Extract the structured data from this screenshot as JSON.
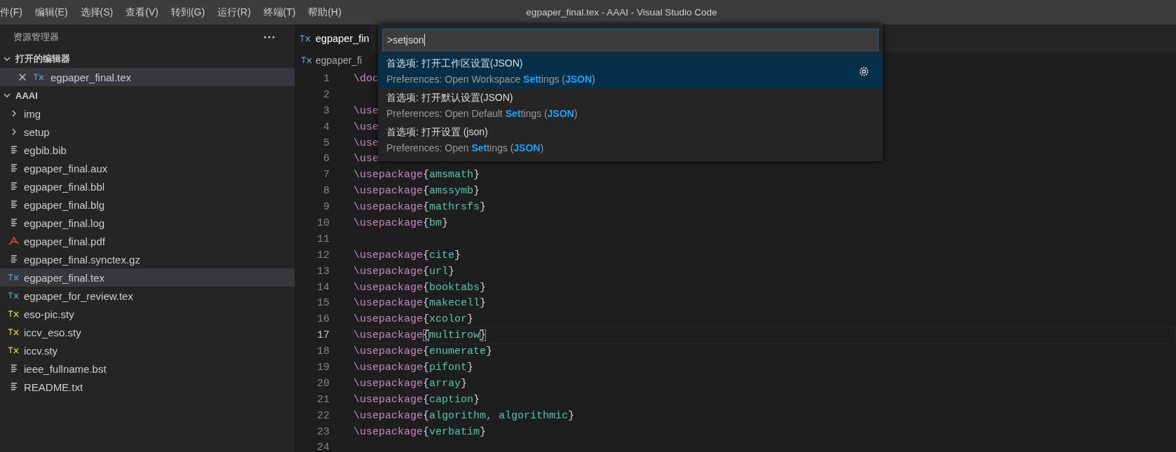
{
  "menu_bar": {
    "items": [
      "件(F)",
      "编辑(E)",
      "选择(S)",
      "查看(V)",
      "转到(G)",
      "运行(R)",
      "终端(T)",
      "帮助(H)"
    ],
    "title": "egpaper_final.tex - AAAI - Visual Studio Code"
  },
  "sidebar": {
    "title": "资源管理器",
    "open_editors": {
      "title": "打开的编辑器",
      "expanded": true,
      "items": [
        {
          "name": "egpaper_final.tex",
          "kind": "tex",
          "selected": true
        }
      ]
    },
    "folder": {
      "title": "AAAI",
      "expanded": true,
      "children": [
        {
          "name": "img",
          "kind": "folder",
          "expanded": false,
          "selected": false
        },
        {
          "name": "setup",
          "kind": "folder",
          "expanded": false,
          "selected": false
        },
        {
          "name": "egbib.bib",
          "kind": "text",
          "selected": false
        },
        {
          "name": "egpaper_final.aux",
          "kind": "text",
          "selected": false
        },
        {
          "name": "egpaper_final.bbl",
          "kind": "text",
          "selected": false
        },
        {
          "name": "egpaper_final.blg",
          "kind": "text",
          "selected": false
        },
        {
          "name": "egpaper_final.log",
          "kind": "text",
          "selected": false
        },
        {
          "name": "egpaper_final.pdf",
          "kind": "pdf",
          "selected": false
        },
        {
          "name": "egpaper_final.synctex.gz",
          "kind": "text",
          "selected": false
        },
        {
          "name": "egpaper_final.tex",
          "kind": "tex",
          "selected": true
        },
        {
          "name": "egpaper_for_review.tex",
          "kind": "tex",
          "selected": false
        },
        {
          "name": "eso-pic.sty",
          "kind": "sty",
          "selected": false
        },
        {
          "name": "iccv_eso.sty",
          "kind": "sty",
          "selected": false
        },
        {
          "name": "iccv.sty",
          "kind": "sty",
          "selected": false
        },
        {
          "name": "ieee_fullname.bst",
          "kind": "text",
          "selected": false
        },
        {
          "name": "README.txt",
          "kind": "text",
          "selected": false
        }
      ]
    }
  },
  "editor": {
    "tab": {
      "label": "egpaper_fin",
      "selected": true
    },
    "breadcrumb": "egpaper_fi",
    "lines": [
      {
        "number": "1",
        "command": "\\doc",
        "current": false
      },
      {
        "number": "2",
        "current": false
      },
      {
        "number": "3",
        "command": "\\use",
        "current": false
      },
      {
        "number": "4",
        "command": "\\use",
        "current": false
      },
      {
        "number": "5",
        "command": "\\use",
        "current": false
      },
      {
        "number": "6",
        "command": "\\use",
        "current": false
      },
      {
        "number": "7",
        "command": "\\usepackage",
        "open": "{",
        "argument": "amsmath",
        "close": "}",
        "current": false
      },
      {
        "number": "8",
        "command": "\\usepackage",
        "open": "{",
        "argument": "amssymb",
        "close": "}",
        "current": false
      },
      {
        "number": "9",
        "command": "\\usepackage",
        "open": "{",
        "argument": "mathrsfs",
        "close": "}",
        "current": false
      },
      {
        "number": "10",
        "command": "\\usepackage",
        "open": "{",
        "argument": "bm",
        "close": "}",
        "current": false
      },
      {
        "number": "11",
        "current": false
      },
      {
        "number": "12",
        "command": "\\usepackage",
        "open": "{",
        "argument": "cite",
        "close": "}",
        "current": false
      },
      {
        "number": "13",
        "command": "\\usepackage",
        "open": "{",
        "argument": "url",
        "close": "}",
        "current": false
      },
      {
        "number": "14",
        "command": "\\usepackage",
        "open": "{",
        "argument": "booktabs",
        "close": "}",
        "current": false
      },
      {
        "number": "15",
        "command": "\\usepackage",
        "open": "{",
        "argument": "makecell",
        "close": "}",
        "current": false
      },
      {
        "number": "16",
        "command": "\\usepackage",
        "open": "{",
        "argument": "xcolor",
        "close": "}",
        "current": false
      },
      {
        "number": "17",
        "command": "\\usepackage",
        "open": "{",
        "argument": "multirow",
        "close": "}",
        "current": true
      },
      {
        "number": "18",
        "command": "\\usepackage",
        "open": "{",
        "argument": "enumerate",
        "close": "}",
        "current": false
      },
      {
        "number": "19",
        "command": "\\usepackage",
        "open": "{",
        "argument": "pifont",
        "close": "}",
        "current": false
      },
      {
        "number": "20",
        "command": "\\usepackage",
        "open": "{",
        "argument": "array",
        "close": "}",
        "current": false
      },
      {
        "number": "21",
        "command": "\\usepackage",
        "open": "{",
        "argument": "caption",
        "close": "}",
        "current": false
      },
      {
        "number": "22",
        "command": "\\usepackage",
        "open": "{",
        "argument": "algorithm, algorithmic",
        "close": "}",
        "current": false
      },
      {
        "number": "23",
        "command": "\\usepackage",
        "open": "{",
        "argument": "verbatim",
        "close": "}",
        "current": false
      },
      {
        "number": "24",
        "current": false
      }
    ]
  },
  "command_palette": {
    "value": ">setjson",
    "items": [
      {
        "title": "首选项: 打开工作区设置(JSON)",
        "detail": "Preferences: Open Workspace **Set**tings (**JSON**)",
        "selected": true
      },
      {
        "title": "首选项: 打开默认设置(JSON)",
        "detail": "Preferences: Open Default **Set**tings (**JSON**)",
        "selected": false
      },
      {
        "title": "首选项: 打开设置 (json)",
        "detail": "Preferences: Open **Set**tings (**JSON**)",
        "selected": false
      }
    ]
  }
}
